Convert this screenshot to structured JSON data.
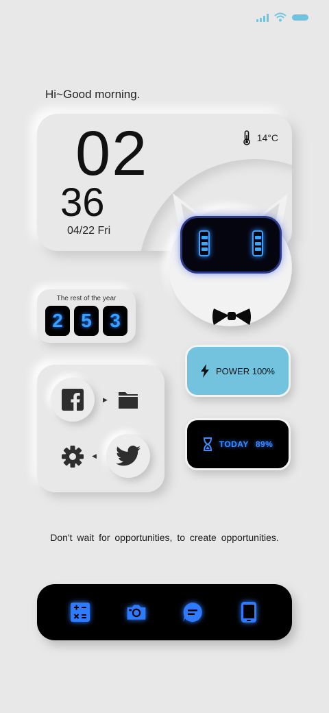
{
  "greeting": "Hi~Good morning.",
  "clock": {
    "hour": "02",
    "minute": "36",
    "date": "04/22 Fri",
    "temperature": "14°C"
  },
  "year_widget": {
    "label": "The rest of the year",
    "digits": [
      "2",
      "5",
      "3"
    ]
  },
  "power_widget": {
    "label": "POWER 100%"
  },
  "today_widget": {
    "label": "TODAY",
    "value": "89%"
  },
  "apps": [
    {
      "name": "facebook-icon"
    },
    {
      "name": "folder-icon"
    },
    {
      "name": "settings-gear-icon"
    },
    {
      "name": "twitter-icon"
    }
  ],
  "quote": "Don't wait for opportunities, to create opportunities.",
  "dock": [
    "calculator-icon",
    "camera-icon",
    "message-icon",
    "phone-icon"
  ],
  "colors": {
    "background": "#e8e8e8",
    "accent_blue": "#3e8dff",
    "power_card": "#73c3df",
    "status_accent": "#6cc4e0"
  }
}
